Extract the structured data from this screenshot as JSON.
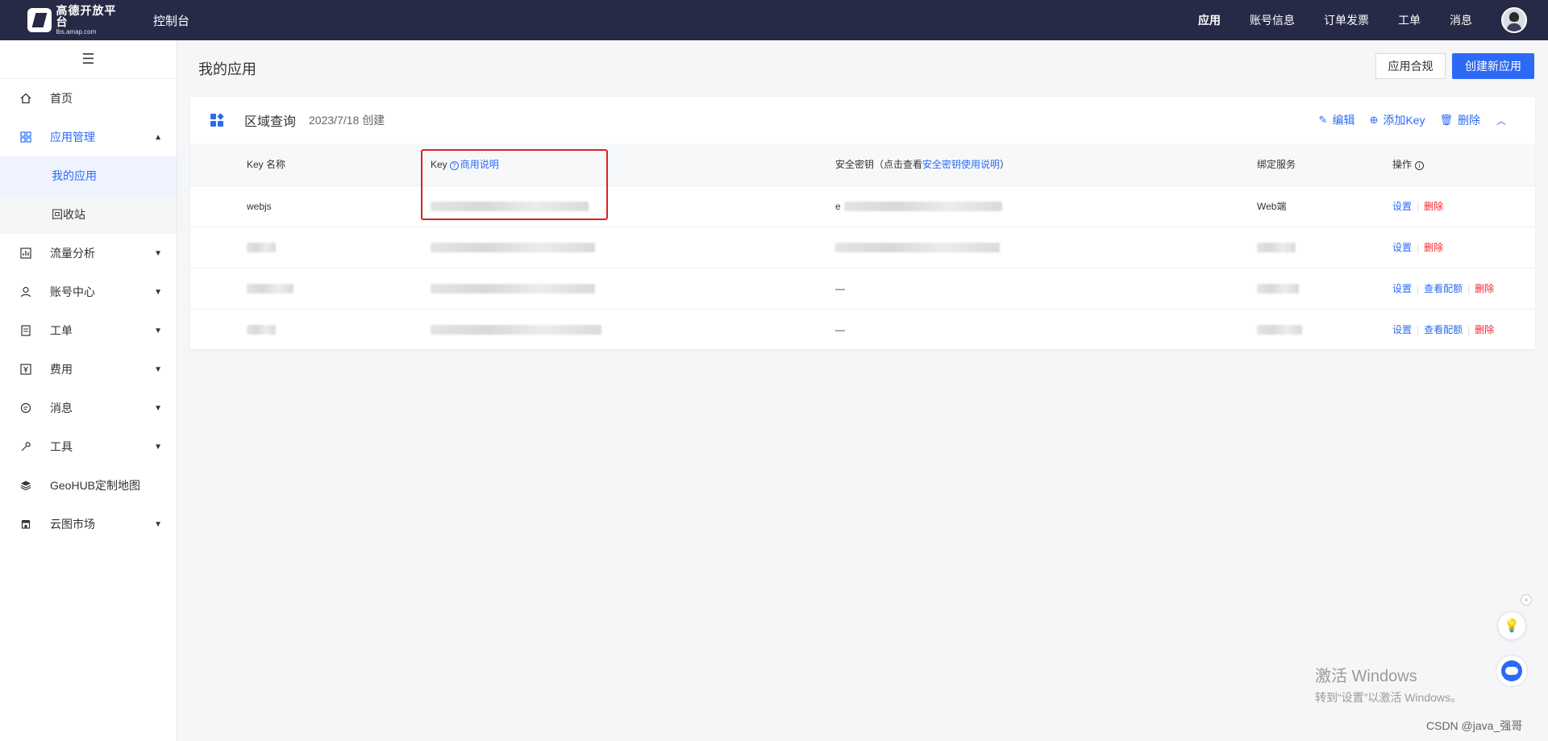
{
  "topbar": {
    "logo_line1": "高德开放平台",
    "logo_line2": "lbs.amap.com",
    "console": "控制台",
    "nav": [
      "应用",
      "账号信息",
      "订单发票",
      "工单",
      "消息"
    ]
  },
  "sidebar": {
    "collapse_glyph": "☰",
    "items": [
      {
        "label": "首页",
        "icon": "home-icon"
      },
      {
        "label": "应用管理",
        "icon": "apps-icon"
      },
      {
        "label": "流量分析",
        "icon": "chart-icon"
      },
      {
        "label": "账号中心",
        "icon": "user-icon"
      },
      {
        "label": "工单",
        "icon": "ticket-icon"
      },
      {
        "label": "费用",
        "icon": "billing-icon"
      },
      {
        "label": "消息",
        "icon": "message-icon"
      },
      {
        "label": "工具",
        "icon": "tool-icon"
      },
      {
        "label": "GeoHUB定制地图",
        "icon": "layers-icon"
      },
      {
        "label": "云图市场",
        "icon": "store-icon"
      }
    ],
    "submenu": [
      "我的应用",
      "回收站"
    ]
  },
  "main": {
    "page_title": "我的应用",
    "btn_compliance": "应用合规",
    "btn_create": "创建新应用",
    "card": {
      "app_name": "区域查询",
      "app_date": "2023/7/18 创建",
      "actions": {
        "edit": "编辑",
        "add_key": "添加Key",
        "delete": "删除"
      },
      "columns": {
        "key_name": "Key 名称",
        "key": "Key",
        "key_link": "商用说明",
        "secret_prefix": "安全密钥（点击查看",
        "secret_link": "安全密钥使用说明",
        "secret_suffix": "）",
        "service": "绑定服务",
        "ops": "操作"
      },
      "rows": [
        {
          "name": "webjs",
          "secret": "e",
          "service": "Web端"
        },
        {
          "name": "",
          "secret": "",
          "service": ""
        },
        {
          "name": "",
          "secret": "—",
          "service": ""
        },
        {
          "name": "",
          "secret": "—",
          "service": ""
        }
      ],
      "ops": {
        "settings": "设置",
        "view_quota": "查看配额",
        "delete": "删除"
      }
    }
  },
  "watermark": {
    "line1": "激活 Windows",
    "line2": "转到“设置”以激活 Windows。"
  },
  "csdn": "CSDN @java_强哥",
  "colors": {
    "accent": "#2c6af5",
    "topbar": "#262a47",
    "danger": "#f5222d",
    "highlight": "#e02020"
  }
}
